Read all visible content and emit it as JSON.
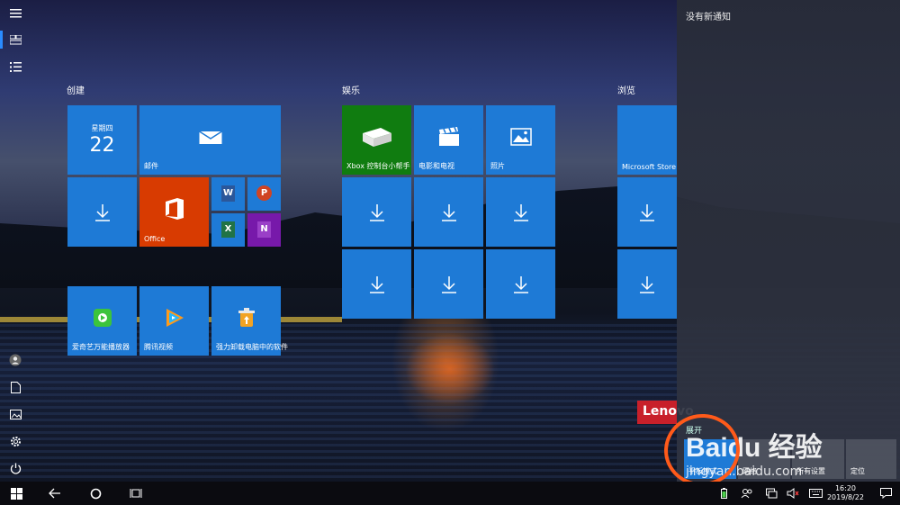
{
  "start": {
    "groups": [
      {
        "id": "create",
        "label": "创建"
      },
      {
        "id": "entertainment",
        "label": "娱乐"
      },
      {
        "id": "browse",
        "label": "浏览"
      }
    ],
    "tiles": {
      "calendar": {
        "weekday": "星期四",
        "day": "22"
      },
      "mail": {
        "label": "邮件"
      },
      "office": {
        "label": "Office"
      },
      "word": {
        "label": "W"
      },
      "powerpoint": {
        "label": "P"
      },
      "excel": {
        "label": "X"
      },
      "onenote": {
        "label": "N"
      },
      "aiqiyi": {
        "label": "爱奇艺万能播放器"
      },
      "tencent_video": {
        "label": "腾讯视频"
      },
      "uninstaller": {
        "label": "强力卸载电脑中的软件"
      },
      "xbox": {
        "label": "Xbox 控制台小帮手"
      },
      "movies": {
        "label": "电影和电视"
      },
      "photos": {
        "label": "照片"
      },
      "store": {
        "label": "Microsoft Store"
      }
    }
  },
  "notifications": {
    "no_new": "没有新通知",
    "expand": "展开",
    "actions": [
      "平板模式",
      "网络",
      "所有设置",
      "定位"
    ]
  },
  "watermark": {
    "brand": "Lenovo",
    "baidu": "Baidu 经验",
    "url": "jingyan.baidu.com"
  },
  "taskbar": {
    "time": "16:20",
    "date": "2019/8/22"
  },
  "colors": {
    "tile": "#1e7ad6",
    "office": "#d83b01",
    "xbox": "#107c10",
    "accent": "#2a8cff",
    "circle": "#ff5a1a"
  }
}
